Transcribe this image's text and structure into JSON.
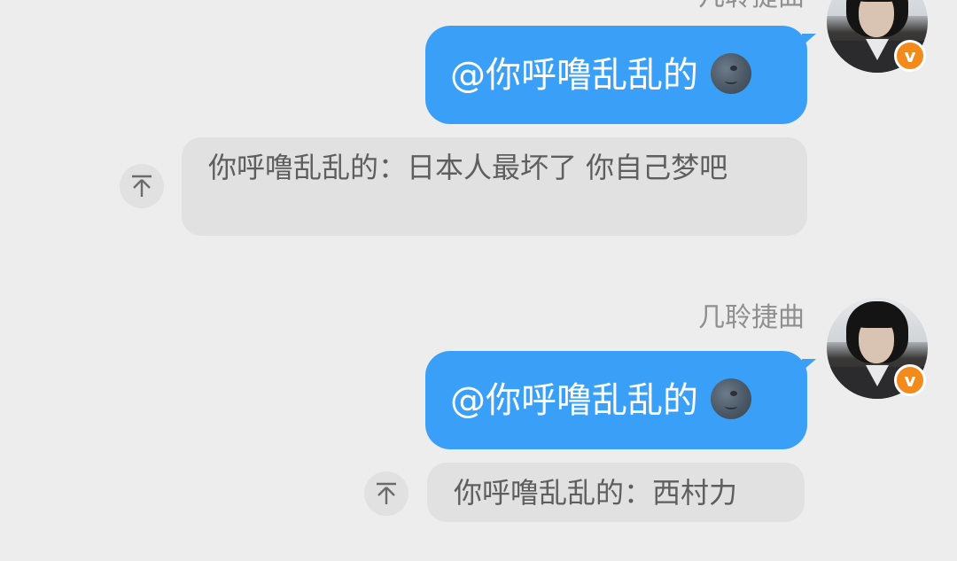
{
  "messages": [
    {
      "sender": "几聆捷曲",
      "text": "@你呼噜乱乱的",
      "emoji": "moon-face",
      "quote": "你呼噜乱乱的：日本人最坏了 你自己梦吧"
    },
    {
      "sender": "几聆捷曲",
      "text": "@你呼噜乱乱的",
      "emoji": "moon-face",
      "quote": "你呼噜乱乱的：西村力"
    }
  ],
  "avatar_badge": "v",
  "colors": {
    "background": "#ededed",
    "sent_bubble": "#3aa0f7",
    "quote_bubble": "#e1e1e1",
    "badge": "#f28a1c"
  }
}
